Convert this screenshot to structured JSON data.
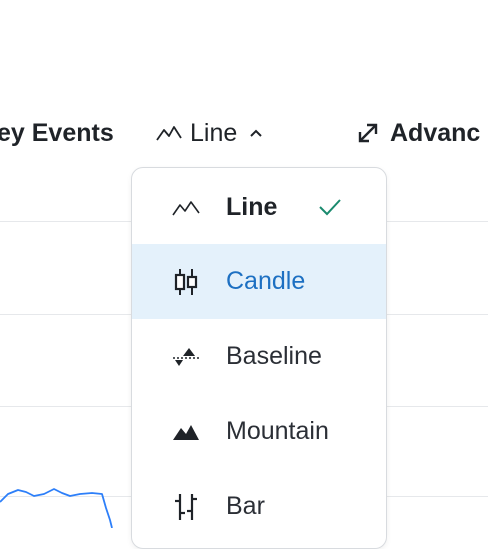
{
  "toolbar": {
    "key_events_label": "ey Events",
    "chart_type_label": "Line",
    "advanced_label": "Advanc"
  },
  "menu": {
    "items": [
      {
        "label": "Line",
        "icon": "line-chart-icon",
        "selected": true
      },
      {
        "label": "Candle",
        "icon": "candle-chart-icon",
        "hovered": true
      },
      {
        "label": "Baseline",
        "icon": "baseline-chart-icon"
      },
      {
        "label": "Mountain",
        "icon": "mountain-chart-icon"
      },
      {
        "label": "Bar",
        "icon": "bar-chart-icon"
      }
    ]
  },
  "colors": {
    "accent": "#1d70c2",
    "hover_bg": "#e4f1fb",
    "check": "#1a8a6e",
    "chart_line": "#2d7ff9",
    "text": "#1f2328"
  }
}
